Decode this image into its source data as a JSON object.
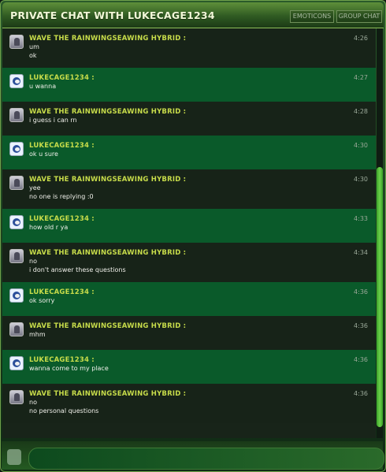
{
  "window": {
    "title": "PRIVATE CHAT WITH LUKECAGE1234",
    "buttons": [
      {
        "label": "EMOTICONS"
      },
      {
        "label": "GROUP CHAT"
      }
    ]
  },
  "messages": [
    {
      "sender": "WAVE THE RAINWINGSEAWING HYBRID :",
      "time": "4:26",
      "avatar": "wave-avatar",
      "lines": [
        "um",
        "ok"
      ]
    },
    {
      "sender": "LUKECAGE1234 :",
      "time": "4:27",
      "avatar": "luke-avatar",
      "lines": [
        "u wanna"
      ]
    },
    {
      "sender": "WAVE THE RAINWINGSEAWING HYBRID :",
      "time": "4:28",
      "avatar": "wave-avatar",
      "lines": [
        "i guess i can rn"
      ]
    },
    {
      "sender": "LUKECAGE1234 :",
      "time": "4:30",
      "avatar": "luke-avatar",
      "lines": [
        "ok u sure"
      ]
    },
    {
      "sender": "WAVE THE RAINWINGSEAWING HYBRID :",
      "time": "4:30",
      "avatar": "wave-avatar",
      "lines": [
        "yee",
        "no one is replying :0"
      ]
    },
    {
      "sender": "LUKECAGE1234 :",
      "time": "4:33",
      "avatar": "luke-avatar",
      "lines": [
        "how old r ya"
      ]
    },
    {
      "sender": "WAVE THE RAINWINGSEAWING HYBRID :",
      "time": "4:34",
      "avatar": "wave-avatar",
      "lines": [
        "no",
        "i don't answer these questions"
      ]
    },
    {
      "sender": "LUKECAGE1234 :",
      "time": "4:36",
      "avatar": "luke-avatar",
      "lines": [
        "ok sorry"
      ]
    },
    {
      "sender": "WAVE THE RAINWINGSEAWING HYBRID :",
      "time": "4:36",
      "avatar": "wave-avatar",
      "lines": [
        "mhm"
      ]
    },
    {
      "sender": "LUKECAGE1234 :",
      "time": "4:36",
      "avatar": "luke-avatar",
      "lines": [
        "wanna come to my place"
      ]
    },
    {
      "sender": "WAVE THE RAINWINGSEAWING HYBRID :",
      "time": "4:36",
      "avatar": "wave-avatar",
      "lines": [
        "no",
        "no personal questions"
      ]
    }
  ],
  "input": {
    "value": "",
    "placeholder": ""
  }
}
